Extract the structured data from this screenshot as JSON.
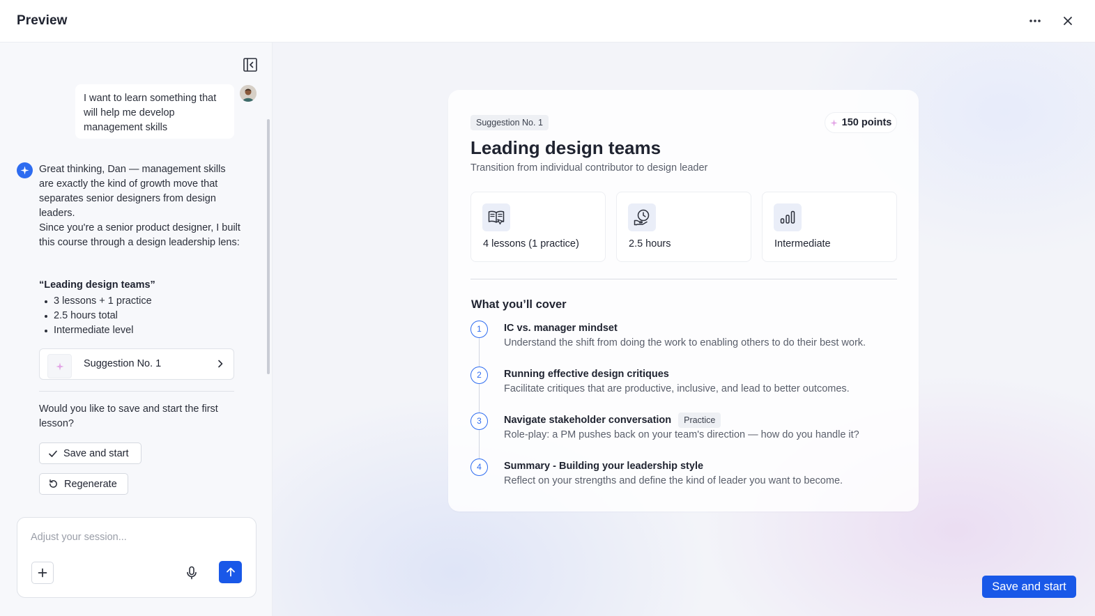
{
  "header": {
    "title": "Preview",
    "more_icon": "more-horizontal-icon",
    "close_icon": "close-icon"
  },
  "chat": {
    "user_message": "I want to learn something that will help me develop management skills",
    "assistant_paragraphs": [
      "Great thinking, Dan — management skills are exactly the kind of growth move that separates senior designers from design leaders.",
      "Since you're a senior product designer, I built this course through a design leadership lens:"
    ],
    "course_quote": "“Leading design teams”",
    "bullets": [
      "3 lessons + 1 practice",
      "2.5 hours total",
      "Intermediate level"
    ],
    "suggestion_card_label": "Suggestion No. 1",
    "question": "Would you like to save and start the first lesson?",
    "save_label": "Save and start",
    "regenerate_label": "Regenerate"
  },
  "composer": {
    "placeholder": "Adjust your session...",
    "value": ""
  },
  "course": {
    "tag": "Suggestion No. 1",
    "points": "150 points",
    "title": "Leading design teams",
    "subtitle": "Transition from individual contributor to design leader",
    "stats": [
      {
        "label": "4 lessons (1 practice)",
        "icon": "book-icon"
      },
      {
        "label": "2.5 hours",
        "icon": "clock-hand-icon"
      },
      {
        "label": "Intermediate",
        "icon": "bar-chart-icon"
      }
    ],
    "cover_title": "What you’ll cover",
    "steps": [
      {
        "num": "1",
        "title": "IC vs. manager mindset",
        "desc": "Understand the shift from doing the work to enabling others to do their best work."
      },
      {
        "num": "2",
        "title": "Running effective design critiques",
        "desc": "Facilitate critiques that are productive, inclusive, and lead to better outcomes."
      },
      {
        "num": "3",
        "title": "Navigate stakeholder conversation",
        "tag": "Practice",
        "desc": "Role-play: a PM pushes back on your team's direction — how do you handle it?"
      },
      {
        "num": "4",
        "title": "Summary - Building your leadership style",
        "desc": "Reflect on your strengths and define the kind of leader you want to become."
      }
    ]
  },
  "footer": {
    "primary_label": "Save and start"
  },
  "colors": {
    "accent": "#1958e8",
    "step_accent": "#2e6cf0",
    "sparkle": "#e3a6e6"
  }
}
